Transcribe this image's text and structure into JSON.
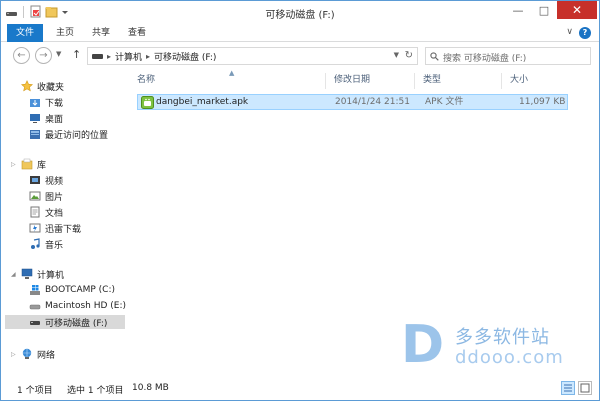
{
  "window": {
    "title": "可移动磁盘 (F:)",
    "controls": {
      "minimize": "—",
      "maximize": "□",
      "close": "✕"
    }
  },
  "ribbon": {
    "tabs": [
      {
        "label": "文件",
        "active": true
      },
      {
        "label": "主页"
      },
      {
        "label": "共享"
      },
      {
        "label": "查看"
      }
    ],
    "help": "?"
  },
  "address_bar": {
    "segments": [
      "计算机",
      "可移动磁盘 (F:)"
    ],
    "search_placeholder": "搜索 可移动磁盘 (F:)"
  },
  "nav_pane": {
    "favorites": {
      "label": "收藏夹",
      "items": [
        {
          "label": "下载",
          "icon": "download-folder-icon"
        },
        {
          "label": "桌面",
          "icon": "desktop-icon"
        },
        {
          "label": "最近访问的位置",
          "icon": "recent-places-icon"
        }
      ]
    },
    "libraries": {
      "label": "库",
      "items": [
        {
          "label": "视频",
          "icon": "video-library-icon"
        },
        {
          "label": "图片",
          "icon": "pictures-library-icon"
        },
        {
          "label": "文档",
          "icon": "documents-library-icon"
        },
        {
          "label": "迅雷下载",
          "icon": "thunder-download-icon"
        },
        {
          "label": "音乐",
          "icon": "music-library-icon"
        }
      ]
    },
    "computer": {
      "label": "计算机",
      "items": [
        {
          "label": "BOOTCAMP (C:)",
          "icon": "windows-drive-icon"
        },
        {
          "label": "Macintosh HD (E:)",
          "icon": "hard-drive-icon"
        },
        {
          "label": "可移动磁盘 (F:)",
          "icon": "removable-drive-icon",
          "selected": true
        }
      ]
    },
    "network": {
      "label": "网络"
    }
  },
  "file_list": {
    "columns": [
      "名称",
      "修改日期",
      "类型",
      "大小"
    ],
    "rows": [
      {
        "name": "dangbei_market.apk",
        "modified": "2014/1/24 21:51",
        "type": "APK 文件",
        "size": "11,097 KB",
        "selected": true
      }
    ]
  },
  "status_bar": {
    "item_count": "1 个项目",
    "selection": "选中 1 个项目",
    "selection_size": "10.8 MB"
  },
  "watermark": {
    "cn": "多多软件站",
    "en": "ddooo.com"
  },
  "colors": {
    "accent": "#1979ca",
    "selection_bg": "#cce8ff",
    "selection_border": "#99d1ff",
    "close_red": "#c7302a"
  }
}
